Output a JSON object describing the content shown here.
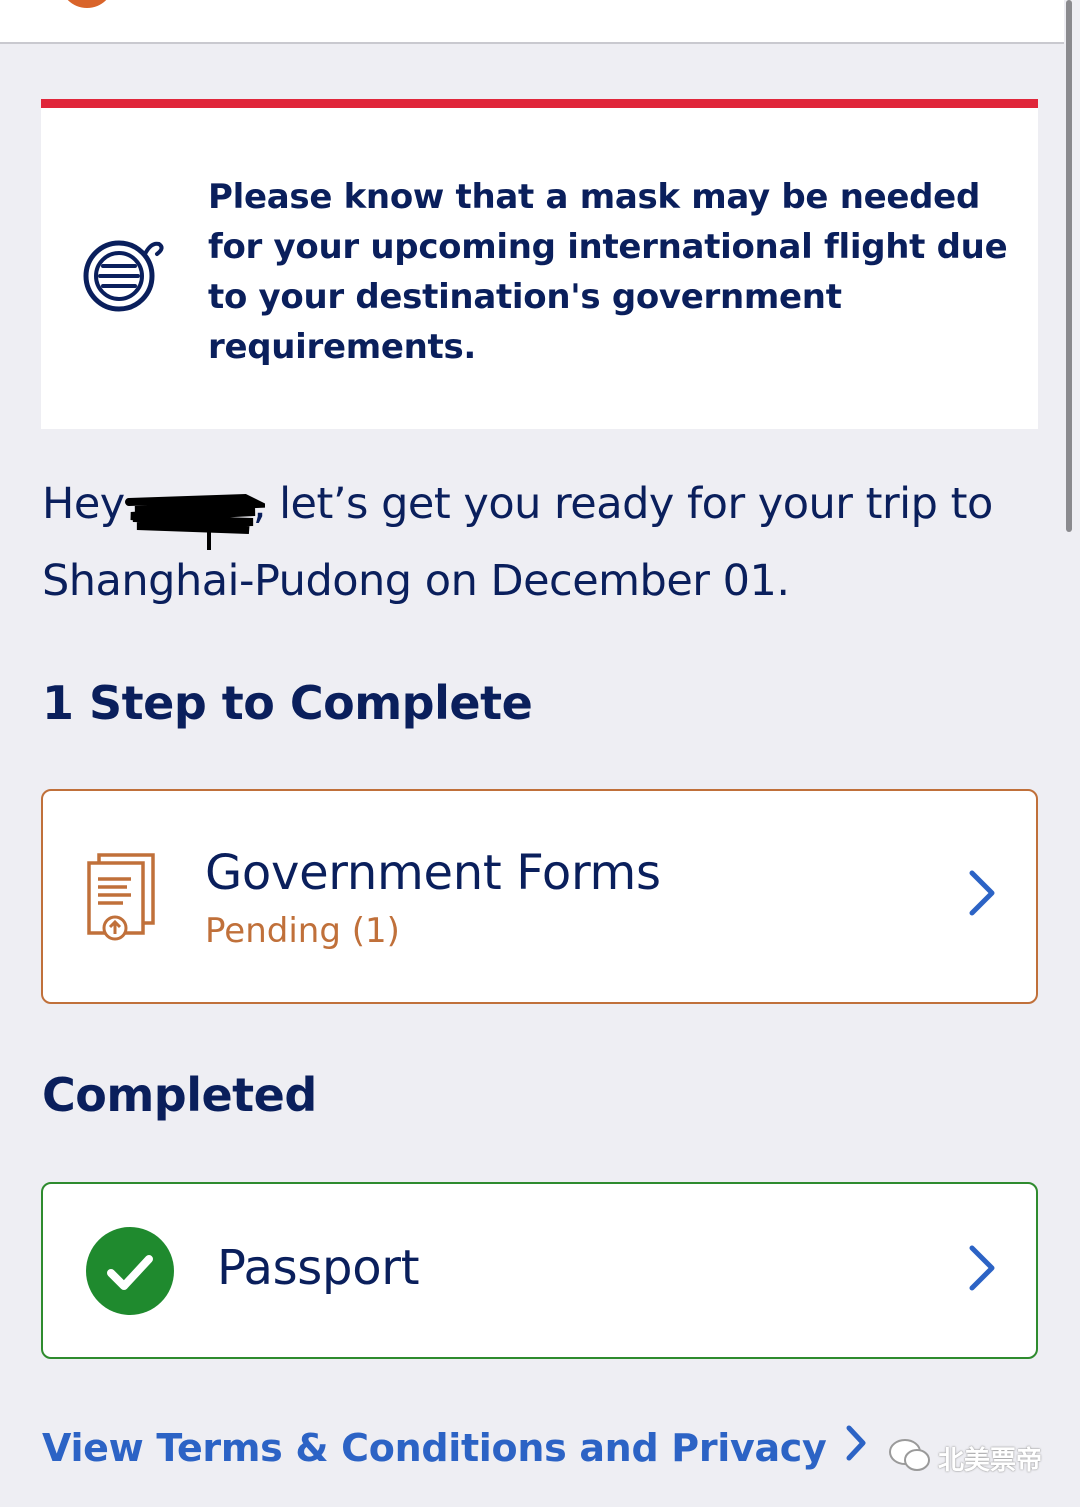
{
  "banner": {
    "text": "Please know that a mask may be needed for your upcoming international flight due to your destination's government requirements.",
    "accent_color": "#e0263a",
    "icon": "face-mask-icon"
  },
  "greeting": {
    "prefix": "Hey",
    "name_redacted": true,
    "suffix": ", let’s get you ready for your trip to Shanghai-Pudong on December 01."
  },
  "steps_section": {
    "title": "1 Step to Complete"
  },
  "forms_card": {
    "title": "Government Forms",
    "status": "Pending (1)",
    "icon": "document-upload-icon",
    "border_color": "#c0703a"
  },
  "completed_section": {
    "title": "Completed"
  },
  "passport_card": {
    "title": "Passport",
    "icon": "checkmark-circle-icon",
    "border_color": "#2e8b2e"
  },
  "footer": {
    "terms_link": "View Terms & Conditions and Privacy"
  },
  "watermark": {
    "text": "北美票帝",
    "icon": "wechat-icon"
  }
}
